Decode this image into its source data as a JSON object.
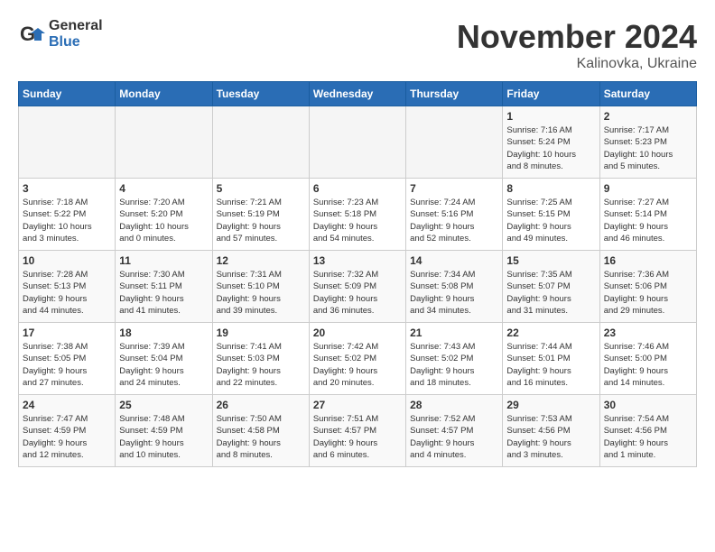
{
  "logo": {
    "general": "General",
    "blue": "Blue"
  },
  "title": {
    "month": "November 2024",
    "location": "Kalinovka, Ukraine"
  },
  "weekdays": [
    "Sunday",
    "Monday",
    "Tuesday",
    "Wednesday",
    "Thursday",
    "Friday",
    "Saturday"
  ],
  "weeks": [
    [
      {
        "day": "",
        "info": ""
      },
      {
        "day": "",
        "info": ""
      },
      {
        "day": "",
        "info": ""
      },
      {
        "day": "",
        "info": ""
      },
      {
        "day": "",
        "info": ""
      },
      {
        "day": "1",
        "info": "Sunrise: 7:16 AM\nSunset: 5:24 PM\nDaylight: 10 hours\nand 8 minutes."
      },
      {
        "day": "2",
        "info": "Sunrise: 7:17 AM\nSunset: 5:23 PM\nDaylight: 10 hours\nand 5 minutes."
      }
    ],
    [
      {
        "day": "3",
        "info": "Sunrise: 7:18 AM\nSunset: 5:22 PM\nDaylight: 10 hours\nand 3 minutes."
      },
      {
        "day": "4",
        "info": "Sunrise: 7:20 AM\nSunset: 5:20 PM\nDaylight: 10 hours\nand 0 minutes."
      },
      {
        "day": "5",
        "info": "Sunrise: 7:21 AM\nSunset: 5:19 PM\nDaylight: 9 hours\nand 57 minutes."
      },
      {
        "day": "6",
        "info": "Sunrise: 7:23 AM\nSunset: 5:18 PM\nDaylight: 9 hours\nand 54 minutes."
      },
      {
        "day": "7",
        "info": "Sunrise: 7:24 AM\nSunset: 5:16 PM\nDaylight: 9 hours\nand 52 minutes."
      },
      {
        "day": "8",
        "info": "Sunrise: 7:25 AM\nSunset: 5:15 PM\nDaylight: 9 hours\nand 49 minutes."
      },
      {
        "day": "9",
        "info": "Sunrise: 7:27 AM\nSunset: 5:14 PM\nDaylight: 9 hours\nand 46 minutes."
      }
    ],
    [
      {
        "day": "10",
        "info": "Sunrise: 7:28 AM\nSunset: 5:13 PM\nDaylight: 9 hours\nand 44 minutes."
      },
      {
        "day": "11",
        "info": "Sunrise: 7:30 AM\nSunset: 5:11 PM\nDaylight: 9 hours\nand 41 minutes."
      },
      {
        "day": "12",
        "info": "Sunrise: 7:31 AM\nSunset: 5:10 PM\nDaylight: 9 hours\nand 39 minutes."
      },
      {
        "day": "13",
        "info": "Sunrise: 7:32 AM\nSunset: 5:09 PM\nDaylight: 9 hours\nand 36 minutes."
      },
      {
        "day": "14",
        "info": "Sunrise: 7:34 AM\nSunset: 5:08 PM\nDaylight: 9 hours\nand 34 minutes."
      },
      {
        "day": "15",
        "info": "Sunrise: 7:35 AM\nSunset: 5:07 PM\nDaylight: 9 hours\nand 31 minutes."
      },
      {
        "day": "16",
        "info": "Sunrise: 7:36 AM\nSunset: 5:06 PM\nDaylight: 9 hours\nand 29 minutes."
      }
    ],
    [
      {
        "day": "17",
        "info": "Sunrise: 7:38 AM\nSunset: 5:05 PM\nDaylight: 9 hours\nand 27 minutes."
      },
      {
        "day": "18",
        "info": "Sunrise: 7:39 AM\nSunset: 5:04 PM\nDaylight: 9 hours\nand 24 minutes."
      },
      {
        "day": "19",
        "info": "Sunrise: 7:41 AM\nSunset: 5:03 PM\nDaylight: 9 hours\nand 22 minutes."
      },
      {
        "day": "20",
        "info": "Sunrise: 7:42 AM\nSunset: 5:02 PM\nDaylight: 9 hours\nand 20 minutes."
      },
      {
        "day": "21",
        "info": "Sunrise: 7:43 AM\nSunset: 5:02 PM\nDaylight: 9 hours\nand 18 minutes."
      },
      {
        "day": "22",
        "info": "Sunrise: 7:44 AM\nSunset: 5:01 PM\nDaylight: 9 hours\nand 16 minutes."
      },
      {
        "day": "23",
        "info": "Sunrise: 7:46 AM\nSunset: 5:00 PM\nDaylight: 9 hours\nand 14 minutes."
      }
    ],
    [
      {
        "day": "24",
        "info": "Sunrise: 7:47 AM\nSunset: 4:59 PM\nDaylight: 9 hours\nand 12 minutes."
      },
      {
        "day": "25",
        "info": "Sunrise: 7:48 AM\nSunset: 4:59 PM\nDaylight: 9 hours\nand 10 minutes."
      },
      {
        "day": "26",
        "info": "Sunrise: 7:50 AM\nSunset: 4:58 PM\nDaylight: 9 hours\nand 8 minutes."
      },
      {
        "day": "27",
        "info": "Sunrise: 7:51 AM\nSunset: 4:57 PM\nDaylight: 9 hours\nand 6 minutes."
      },
      {
        "day": "28",
        "info": "Sunrise: 7:52 AM\nSunset: 4:57 PM\nDaylight: 9 hours\nand 4 minutes."
      },
      {
        "day": "29",
        "info": "Sunrise: 7:53 AM\nSunset: 4:56 PM\nDaylight: 9 hours\nand 3 minutes."
      },
      {
        "day": "30",
        "info": "Sunrise: 7:54 AM\nSunset: 4:56 PM\nDaylight: 9 hours\nand 1 minute."
      }
    ]
  ]
}
